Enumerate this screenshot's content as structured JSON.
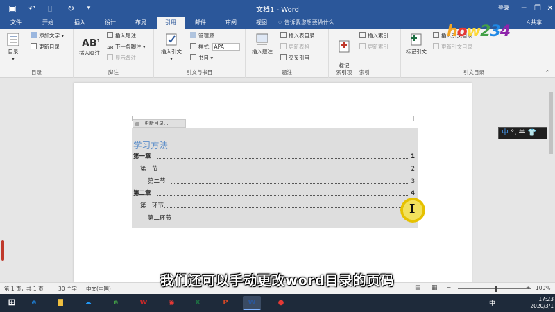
{
  "window": {
    "title": "文档1 - Word",
    "login": "登录",
    "minimize": "─",
    "restore": "❐",
    "close": "✕"
  },
  "tabs": [
    {
      "label": "文件"
    },
    {
      "label": "开始"
    },
    {
      "label": "插入"
    },
    {
      "label": "设计"
    },
    {
      "label": "布局"
    },
    {
      "label": "引用"
    },
    {
      "label": "邮件"
    },
    {
      "label": "审阅"
    },
    {
      "label": "视图"
    }
  ],
  "tell_me": "告诉我您想要做什么...",
  "share": "共享",
  "ribbon": {
    "toc_group": {
      "label": "目录",
      "toc_button": "目录",
      "add_text": "添加文字",
      "update_toc": "更新目录"
    },
    "footnote_group": {
      "label": "脚注",
      "insert_footnote": "插入脚注",
      "insert_endnote": "插入尾注",
      "next_footnote": "下一条脚注",
      "show_notes": "显示备注"
    },
    "citation_group": {
      "label": "引文与书目",
      "insert_citation": "插入引文",
      "manage_sources": "管理源",
      "style_label": "样式:",
      "style_value": "APA",
      "bibliography": "书目"
    },
    "caption_group": {
      "label": "题注",
      "insert_caption": "插入题注",
      "insert_table_of_figures": "插入表目录",
      "update_table": "更新表格",
      "cross_reference": "交叉引用"
    },
    "index_group": {
      "label": "索引",
      "mark_entry": "标记\n索引项",
      "insert_index": "插入索引",
      "update_index": "更新索引"
    },
    "citation_table_group": {
      "label": "引文目录",
      "mark_citation": "标记引文",
      "insert_table_of_authorities": "插入引文目录",
      "update_table": "更新引文目录"
    }
  },
  "document": {
    "toc_handle_label": "更新目录...",
    "toc_heading": "学习方法",
    "entries": [
      {
        "text": "第一章",
        "page": "1",
        "level": 1
      },
      {
        "text": "第一节",
        "page": "2",
        "level": 2
      },
      {
        "text": "第二节",
        "page": "3",
        "level": 3
      },
      {
        "text": "第二章",
        "page": "4",
        "level": 1
      },
      {
        "text": "第一环节",
        "page": "5",
        "level": 2
      },
      {
        "text": "第二环节",
        "page": "6",
        "level": 3
      }
    ]
  },
  "ime": {
    "lang": "中",
    "mode": "°, 半"
  },
  "subtitle": "我们还可以手动更改word目录的页码",
  "status": {
    "page": "第 1 页，共 1 页",
    "words": "30 个字",
    "language": "中文(中国)",
    "zoom": "100%"
  },
  "taskbar": {
    "apps": [
      {
        "name": "ie",
        "glyph": "e",
        "color": "#1e88e5"
      },
      {
        "name": "explorer",
        "glyph": "▇",
        "color": "#f0c040"
      },
      {
        "name": "baidu-netdisk",
        "glyph": "☁",
        "color": "#2196f3"
      },
      {
        "name": "360-browser",
        "glyph": "e",
        "color": "#43a047"
      },
      {
        "name": "wps",
        "glyph": "W",
        "color": "#c62828"
      },
      {
        "name": "chrome",
        "glyph": "◉",
        "color": "#e53935"
      },
      {
        "name": "excel",
        "glyph": "X",
        "color": "#1d6f42"
      },
      {
        "name": "powerpoint",
        "glyph": "P",
        "color": "#d24726"
      },
      {
        "name": "word",
        "glyph": "W",
        "color": "#2b579a"
      },
      {
        "name": "recorder",
        "glyph": "●",
        "color": "#e53935"
      }
    ],
    "ime_indicator": "中",
    "time": "17:23",
    "date": "2020/3/1"
  },
  "colors": {
    "word_blue": "#2b579a",
    "toc_heading": "#5b8dc9",
    "highlight": "#f2e15c"
  },
  "icons": {
    "save": "save-icon",
    "undo": "undo-icon",
    "new": "new-document-icon",
    "redo": "redo-icon"
  }
}
